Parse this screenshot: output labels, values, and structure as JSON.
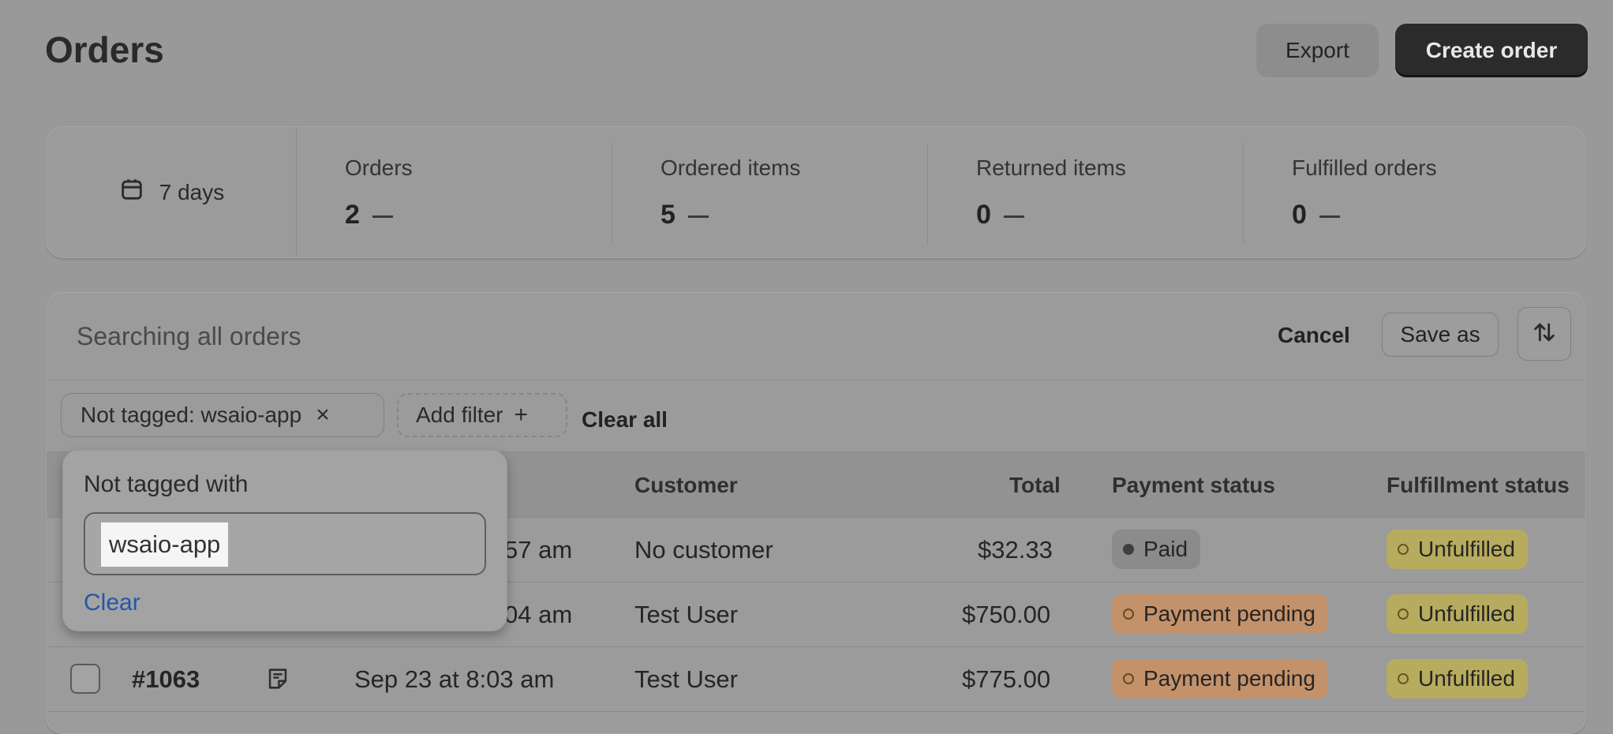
{
  "page": {
    "title": "Orders"
  },
  "actions": {
    "export_label": "Export",
    "create_label": "Create order"
  },
  "stats": {
    "period": {
      "label": "7 days",
      "icon": "calendar-icon"
    },
    "items": [
      {
        "label": "Orders",
        "value": "2"
      },
      {
        "label": "Ordered items",
        "value": "5"
      },
      {
        "label": "Returned items",
        "value": "0"
      },
      {
        "label": "Fulfilled orders",
        "value": "0"
      }
    ]
  },
  "search": {
    "placeholder": "Searching all orders",
    "cancel_label": "Cancel",
    "save_as_label": "Save as",
    "sort_icon": "sort-icon"
  },
  "filters": {
    "active_filter": "Not tagged: wsaio-app",
    "remove_icon": "close-icon",
    "add_filter_label": "Add filter",
    "add_icon": "plus-icon",
    "clear_all_label": "Clear all"
  },
  "popover": {
    "label": "Not tagged with",
    "input_value": "wsaio-app",
    "clear_label": "Clear"
  },
  "table": {
    "columns": {
      "customer": "Customer",
      "total": "Total",
      "payment": "Payment status",
      "fulfillment": "Fulfillment status"
    },
    "rows": [
      {
        "order": "",
        "date": "57 am",
        "customer": "No customer",
        "total": "$32.33",
        "payment": "Paid",
        "fulfillment": "Unfulfilled"
      },
      {
        "order": "",
        "date": "04 am",
        "customer": "Test User",
        "total": "$750.00",
        "payment": "Payment pending",
        "fulfillment": "Unfulfilled"
      },
      {
        "order": "#1063",
        "date": "Sep 23 at 8:03 am",
        "customer": "Test User",
        "total": "$775.00",
        "payment": "Payment pending",
        "fulfillment": "Unfulfilled"
      }
    ]
  },
  "colors": {
    "overlay": "#999999",
    "link": "#2556a8",
    "pending_badge": "#c4926a",
    "unfulfilled_badge": "#b7ac5d"
  }
}
